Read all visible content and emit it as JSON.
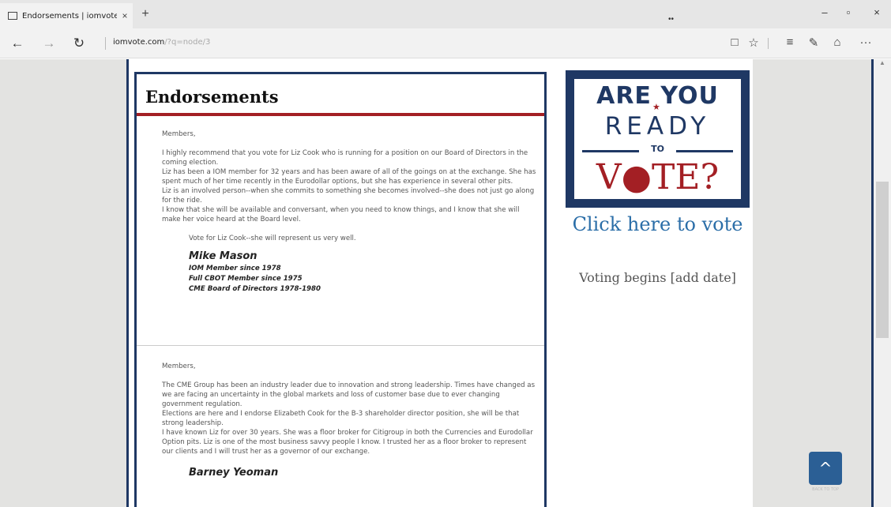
{
  "browser": {
    "tab_title": "Endorsements | iomvote",
    "tab_close": "×",
    "new_tab": "+",
    "tab_mid": "••",
    "window_controls": {
      "minimize": "–",
      "maximize": "▫",
      "close": "×"
    },
    "nav": {
      "back": "←",
      "forward": "→",
      "refresh": "↻"
    },
    "url_host": "iomvote.com",
    "url_path": "/?q=node/3",
    "tools": {
      "reading_view": "□",
      "favorite": "☆",
      "hub": "≡",
      "web_note": "✎",
      "share": "⌂",
      "more": "···"
    }
  },
  "page": {
    "title": "Endorsements",
    "letters": [
      {
        "salutation": "Members,",
        "paragraphs": [
          "I highly recommend that you vote for  Liz Cook who is running for a position on our Board of Directors in the coming election.",
          "Liz has been a IOM member for 32 years  and has been aware of all of the goings on at the exchange.  She has spent much of her time recently in the Eurodollar options, but she has experience in several other pits.",
          "Liz is an involved person--when she commits to something she becomes involved--she does not just go along for the ride.",
          "I know that she will be available and conversant, when you need to know things, and I know that she will make her voice heard at the Board level."
        ],
        "closing": "Vote for Liz Cook--she will represent us very well.",
        "signature": "Mike Mason",
        "credentials": [
          "IOM Member since 1978",
          "Full CBOT Member since 1975",
          "CME Board of Directors 1978-1980"
        ]
      },
      {
        "salutation": "Members,",
        "paragraphs": [
          "The CME Group has been an industry leader due to innovation and strong leadership.  Times have changed as we are facing an uncertainty in the global markets and loss of customer base due to ever changing government regulation.",
          "Elections are here and I endorse Elizabeth Cook for the B-3 shareholder director position, she will be that strong leadership.",
          "I have known Liz for over 30 years. She was a floor broker for Citigroup in both the Currencies and Eurodollar Option pits. Liz is one of the most business savvy people I know. I trusted her as a floor broker to represent our clients and I will trust her as a governor of our exchange."
        ],
        "signature": "Barney Yeoman"
      }
    ]
  },
  "sidebar": {
    "banner": {
      "line1": "ARE YOU",
      "star": "★",
      "line2": "READY",
      "line3": "TO",
      "line4": "V●TE?"
    },
    "vote_link": "Click here to vote",
    "voting_begins": "Voting begins [add date]"
  },
  "back_to_top": {
    "icon": "^",
    "label": "BACK TO TOP"
  },
  "icons": {
    "tab": "page-icon",
    "back_to_top": "chevron-up-icon"
  }
}
